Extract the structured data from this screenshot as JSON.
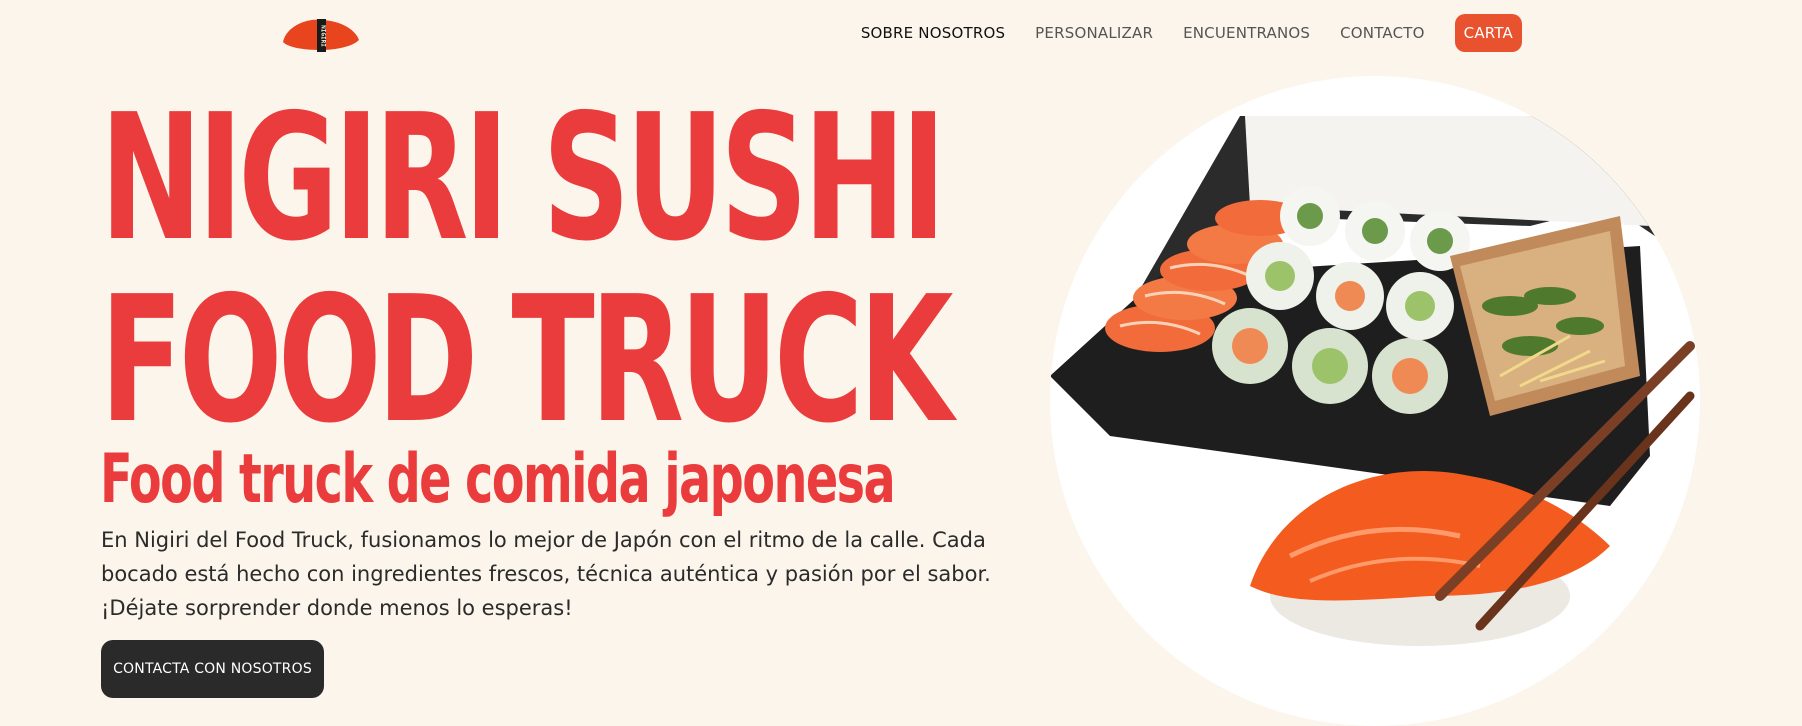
{
  "brand": {
    "logo_text": "NIGIRI",
    "accent_color": "#e8522f",
    "title_color": "#ea3c3c"
  },
  "nav": {
    "items": [
      {
        "label": "SOBRE NOSOTROS",
        "active": true
      },
      {
        "label": "PERSONALIZAR",
        "active": false
      },
      {
        "label": "ENCUENTRANOS",
        "active": false
      },
      {
        "label": "CONTACTO",
        "active": false
      }
    ],
    "cta_label": "CARTA"
  },
  "hero": {
    "title_line1": "NIGIRI SUSHI",
    "title_line2": "FOOD TRUCK",
    "subtitle": "Food truck de comida japonesa",
    "description": "En Nigiri del Food Truck, fusionamos lo mejor de Japón con el ritmo de la calle. Cada bocado está hecho con ingredientes frescos, técnica auténtica y pasión por el sabor. ¡Déjate sorprender donde menos lo esperas!",
    "button_label": "CONTACTA CON NOSOTROS",
    "image_subject": "sushi-box-and-nigiri-photo"
  }
}
